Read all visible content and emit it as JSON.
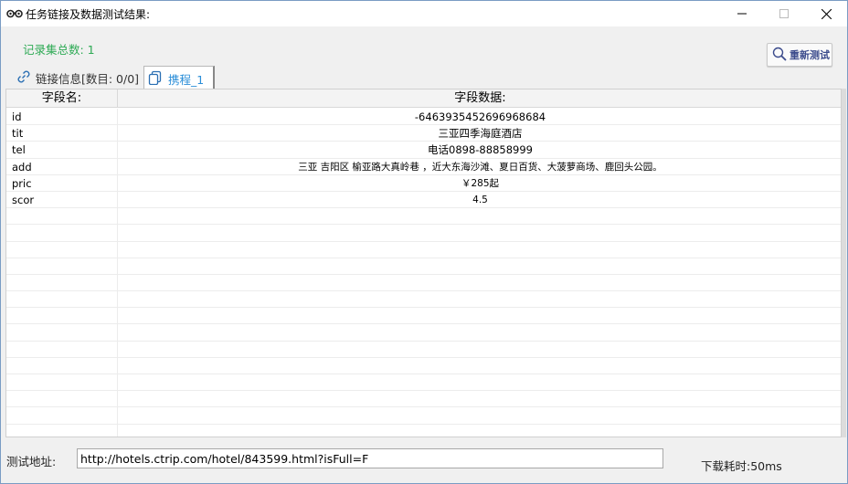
{
  "window": {
    "title": "任务链接及数据测试结果:",
    "icon": "binoculars-icon"
  },
  "toolbar": {
    "record_count": "记录集总数: 1",
    "retest_label": "重新测试",
    "retest_icon": "magnifier-icon"
  },
  "tabs": [
    {
      "label": "链接信息[数目: 0/0]",
      "icon": "link-icon",
      "active": false
    },
    {
      "label": "携程_1",
      "icon": "copy-icon",
      "active": true
    }
  ],
  "grid": {
    "headers": [
      "字段名:",
      "字段数据:"
    ],
    "rows": [
      {
        "name": "id",
        "value": "-6463935452696968684"
      },
      {
        "name": "tit",
        "value": "三亚四季海庭酒店"
      },
      {
        "name": "tel",
        "value": "电话0898-88858999"
      },
      {
        "name": "add",
        "value": "三亚 吉阳区 榆亚路大真岭巷 ，近大东海沙滩、夏日百货、大菠萝商场、鹿回头公园。"
      },
      {
        "name": "pric",
        "value": "￥285起"
      },
      {
        "name": "scor",
        "value": "4.5"
      }
    ]
  },
  "footer": {
    "url_label": "测试地址:",
    "url_value": "http://hotels.ctrip.com/hotel/843599.html?isFull=F",
    "download_time": "下载耗时:50ms"
  },
  "colors": {
    "record_count": "#2eaa55",
    "active_tab": "#2b8ed8",
    "retest_text": "#3b4b8c"
  }
}
